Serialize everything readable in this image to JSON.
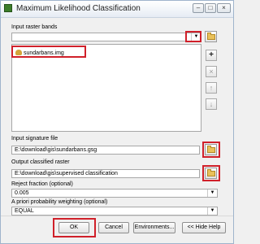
{
  "window": {
    "title": "Maximum Likelihood Classification"
  },
  "input_raster_bands": {
    "label": "Input raster bands",
    "value": "",
    "items": [
      "sundarbans.img"
    ]
  },
  "input_signature_file": {
    "label": "Input signature file",
    "value": "E:\\download\\gis\\sundarbans.gsg"
  },
  "output_classified_raster": {
    "label": "Output classified raster",
    "value": "E:\\download\\gis\\supervised classification"
  },
  "reject_fraction": {
    "label": "Reject fraction (optional)",
    "value": "0.005"
  },
  "a_priori_weighting": {
    "label": "A priori probability weighting (optional)",
    "value": "EQUAL"
  },
  "side_buttons": {
    "add": "+",
    "remove": "×",
    "up": "↑",
    "down": "↓"
  },
  "window_buttons": {
    "minimize": "–",
    "maximize": "□",
    "close": "×"
  },
  "buttons": {
    "ok": "OK",
    "cancel": "Cancel",
    "environments": "Environments...",
    "hide_help": "<< Hide Help"
  },
  "colors": {
    "highlight": "#d0202a"
  }
}
